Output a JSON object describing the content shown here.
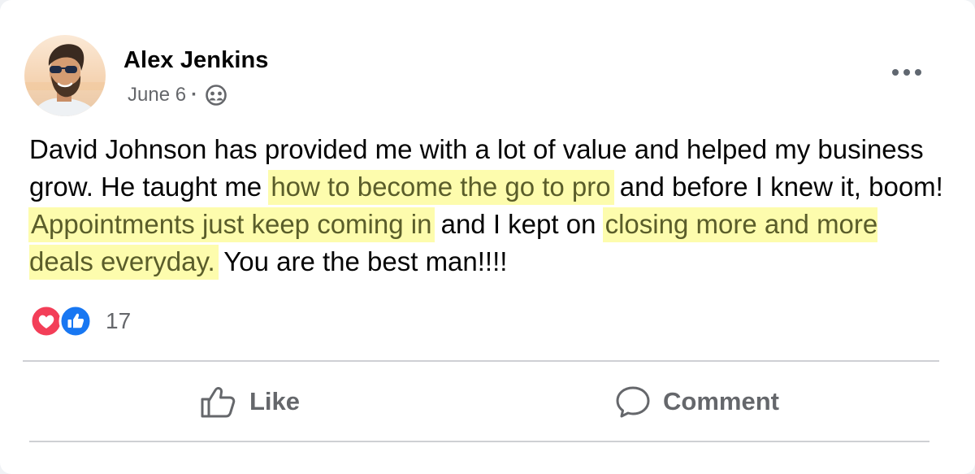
{
  "post": {
    "author": "Alex Jenkins",
    "date": "June 6",
    "separator": "·",
    "audience_icon": "friends-icon",
    "more_icon": "more-options-icon",
    "text": [
      {
        "t": "David Johnson has provided me with a lot of value and helped my business grow. He taught me ",
        "hl": false
      },
      {
        "t": "how to become the go to pro",
        "hl": true
      },
      {
        "t": " and before I knew it, boom! ",
        "hl": false
      },
      {
        "t": "Appointments just keep coming in",
        "hl": true
      },
      {
        "t": " and I kept on ",
        "hl": false
      },
      {
        "t": "closing more and more deals everyday.",
        "hl": true
      },
      {
        "t": " You are the best man!!!!",
        "hl": false
      }
    ],
    "highlight_color": "#fdfcad",
    "reactions": {
      "icons": [
        "love-reaction-icon",
        "like-reaction-icon"
      ],
      "count": "17"
    },
    "actions": {
      "like_label": "Like",
      "comment_label": "Comment"
    }
  },
  "colors": {
    "love": "#f33e58",
    "like": "#1877f2",
    "secondary_text": "#65676b",
    "primary_text": "#050505"
  }
}
